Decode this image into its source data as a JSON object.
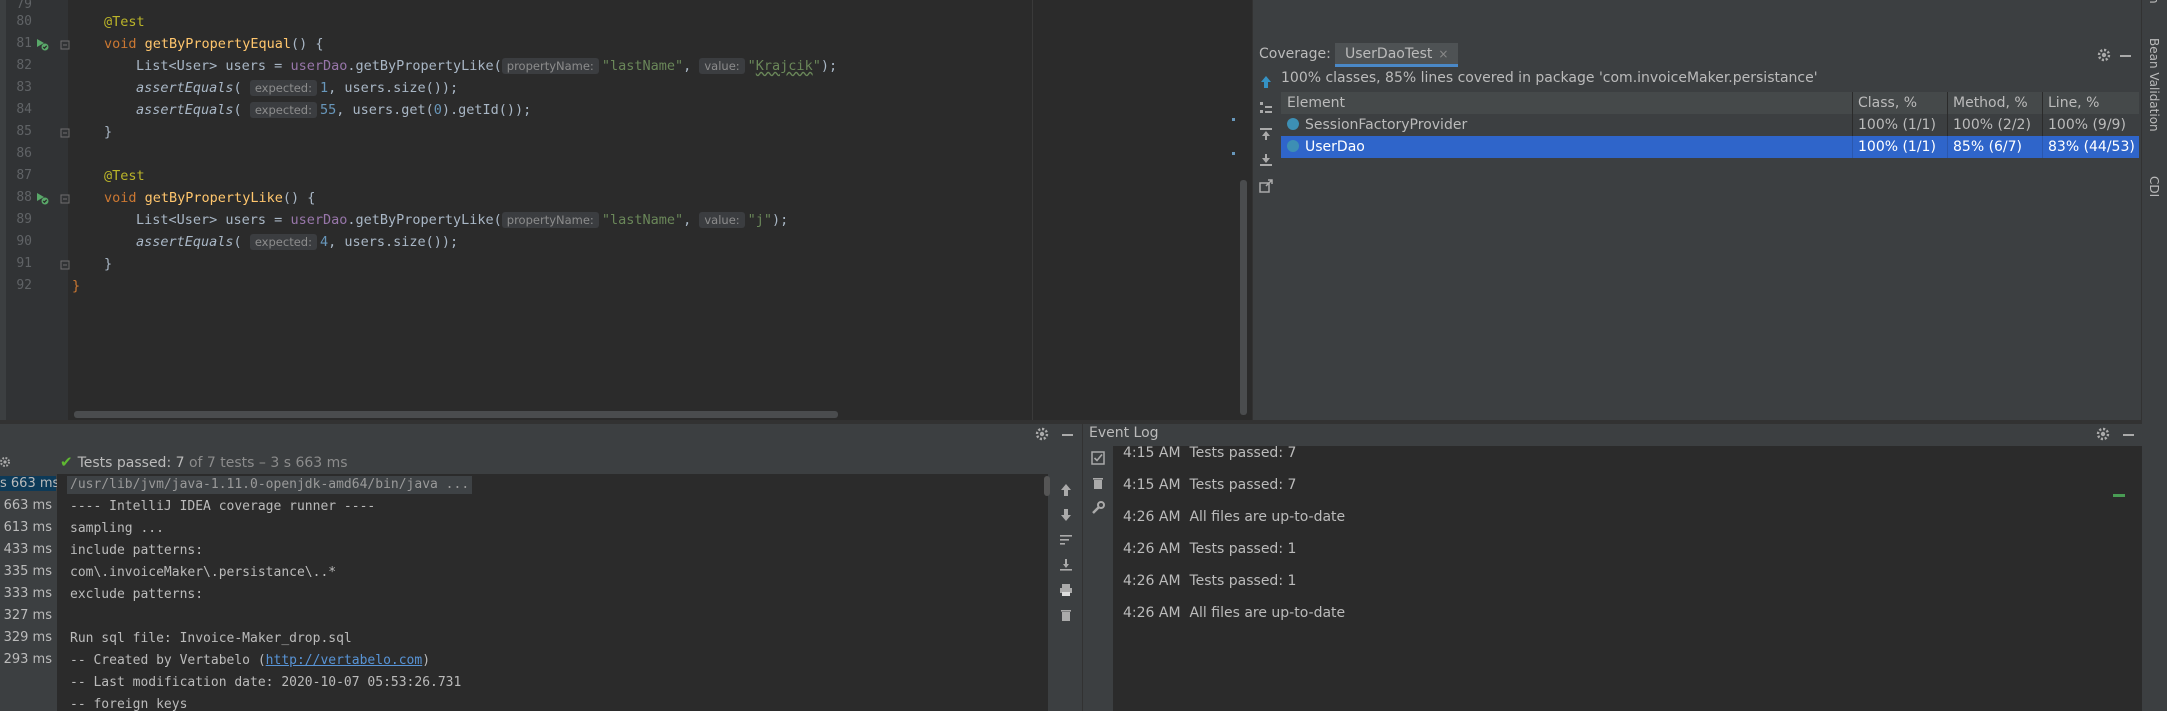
{
  "editor": {
    "line_numbers": [
      "79",
      "80",
      "81",
      "82",
      "83",
      "84",
      "85",
      "86",
      "87",
      "88",
      "89",
      "90",
      "91",
      "92"
    ],
    "lines": {
      "l80": "@Test",
      "l81_kw": "void",
      "l81_fn": "getByPropertyEqual",
      "l81_rest": "() {",
      "l82_a": "List<User> users = ",
      "l82_field": "userDao",
      "l82_b": ".getByPropertyLike(",
      "l82_hint1": "propertyName:",
      "l82_s1": "\"lastName\"",
      "l82_c": ", ",
      "l82_hint2": "value:",
      "l82_s2a": "\"",
      "l82_s2b": "Krajcik",
      "l82_s2c": "\"",
      "l82_d": ");",
      "l83_fn": "assertEquals",
      "l83_a": "( ",
      "l83_hint": "expected:",
      "l83_num": "1",
      "l83_b": ", users.size());",
      "l84_fn": "assertEquals",
      "l84_a": "( ",
      "l84_hint": "expected:",
      "l84_num": "55",
      "l84_b": ", users.get(",
      "l84_num2": "0",
      "l84_c": ").getId());",
      "l85": "}",
      "l87": "@Test",
      "l88_kw": "void",
      "l88_fn": "getByPropertyLike",
      "l88_rest": "() {",
      "l89_a": "List<User> users = ",
      "l89_field": "userDao",
      "l89_b": ".getByPropertyLike(",
      "l89_hint1": "propertyName:",
      "l89_s1": "\"lastName\"",
      "l89_c": ", ",
      "l89_hint2": "value:",
      "l89_s2": "\"j\"",
      "l89_d": ");",
      "l90_fn": "assertEquals",
      "l90_a": "( ",
      "l90_hint": "expected:",
      "l90_num": "4",
      "l90_b": ", users.size());",
      "l91": "}",
      "l92": "}"
    }
  },
  "coverage": {
    "label": "Coverage:",
    "tab_label": "UserDaoTest",
    "tab_close": "×",
    "summary": "100% classes, 85% lines covered in package 'com.invoiceMaker.persistance'",
    "columns": [
      "Element",
      "Class, %",
      "Method, %",
      "Line, %"
    ],
    "rows": [
      {
        "element": "SessionFactoryProvider",
        "class": "100% (1/1)",
        "method": "100% (2/2)",
        "line": "100% (9/9)"
      },
      {
        "element": "UserDao",
        "class": "100% (1/1)",
        "method": "85% (6/7)",
        "line": "83% (44/53)"
      }
    ]
  },
  "right_strip": {
    "item1": "Bean Validation",
    "item2": "CDI",
    "item0": "n"
  },
  "run": {
    "status_passed": "Tests passed: 7",
    "status_rest": " of 7 tests – 3 s 663 ms",
    "check": "✔",
    "tree_times": [
      "s 663 ms",
      "s 663 ms",
      "s 613 ms",
      "433 ms",
      "335 ms",
      "333 ms",
      "327 ms",
      "329 ms",
      "293 ms"
    ],
    "console_lines": [
      "/usr/lib/jvm/java-1.11.0-openjdk-amd64/bin/java ...",
      "---- IntelliJ IDEA coverage runner ----",
      "sampling ...",
      "include patterns:",
      "com\\.invoiceMaker\\.persistance\\..*",
      "exclude patterns:",
      "",
      "Run sql file: Invoice-Maker_drop.sql",
      "-- Created by Vertabelo (",
      "-- Last modification date: 2020-10-07 05:53:26.731",
      "-- foreign keys"
    ],
    "link": "http://vertabelo.com",
    "link_after": ")"
  },
  "event_log": {
    "title": "Event Log",
    "events": [
      {
        "time": "4:15 AM",
        "text": "Tests passed: 7"
      },
      {
        "time": "4:15 AM",
        "text": "Tests passed: 7"
      },
      {
        "time": "4:26 AM",
        "text": "All files are up-to-date"
      },
      {
        "time": "4:26 AM",
        "text": "Tests passed: 1"
      },
      {
        "time": "4:26 AM",
        "text": "Tests passed: 1"
      },
      {
        "time": "4:26 AM",
        "text": "All files are up-to-date"
      }
    ]
  },
  "colors": {
    "background": "#2b2b2b",
    "panel": "#3c3f41",
    "selection": "#2f65ca",
    "keyword": "#cc7832",
    "string": "#6a8759",
    "function": "#ffc66d",
    "annotation": "#bbb529",
    "number": "#6897bb",
    "field": "#9876aa",
    "success": "#5fb832",
    "link": "#5894d6"
  }
}
